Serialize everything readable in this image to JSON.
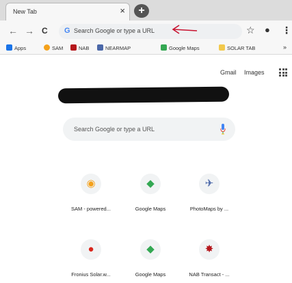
{
  "tab": {
    "title": "New Tab",
    "close_glyph": "×"
  },
  "new_tab_glyph": "+",
  "toolbar": {
    "back_glyph": "←",
    "forward_glyph": "→",
    "reload_glyph": "C",
    "omnibox_icon": "G",
    "omnibox_placeholder": "Search Google or type a URL",
    "star_glyph": "☆",
    "profile_glyph": "●",
    "menu_glyph": "⋮"
  },
  "bookmarks": [
    {
      "label": "Apps",
      "color": "#1a73e8",
      "icon": "apps-grid-icon"
    },
    {
      "label": "SAM",
      "color": "#f4a11b",
      "icon": "sam-icon"
    },
    {
      "label": "NAB",
      "color": "#b5161b",
      "icon": "nab-star-icon"
    },
    {
      "label": "NEARMAP",
      "color": "#4a67a8",
      "icon": "nearmap-icon"
    },
    {
      "label": "Google Maps",
      "color": "#34a853",
      "icon": "google-maps-icon"
    },
    {
      "label": "SOLAR TAB",
      "color": "#f2c94c",
      "icon": "folder-icon"
    }
  ],
  "bookmarks_overflow": "»",
  "top_links": {
    "gmail": "Gmail",
    "images": "Images"
  },
  "search": {
    "placeholder": "Search Google or type a URL"
  },
  "tiles": [
    {
      "label": "SAM - powered...",
      "glyph": "◉",
      "color": "#f4a11b",
      "icon": "sam-icon"
    },
    {
      "label": "Google Maps",
      "glyph": "◆",
      "color": "#34a853",
      "icon": "google-maps-icon"
    },
    {
      "label": "PhotoMaps by ...",
      "glyph": "✈",
      "color": "#4a67a8",
      "icon": "photomaps-icon"
    },
    {
      "label": "Fronius Solar.w...",
      "glyph": "●",
      "color": "#d9261c",
      "icon": "fronius-icon"
    },
    {
      "label": "Google Maps",
      "glyph": "◆",
      "color": "#34a853",
      "icon": "google-maps-icon"
    },
    {
      "label": "NAB Transact - ...",
      "glyph": "✸",
      "color": "#b5161b",
      "icon": "nab-star-icon"
    }
  ],
  "colors": {
    "annotation": "#c8102e",
    "accent": "#4285f4"
  }
}
